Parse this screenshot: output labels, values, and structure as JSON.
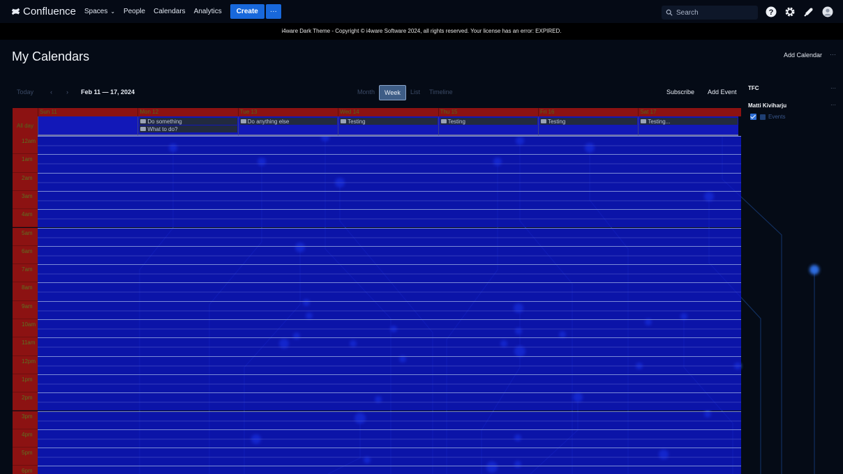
{
  "topnav": {
    "logo_text": "Confluence",
    "spaces": "Spaces",
    "people": "People",
    "calendars": "Calendars",
    "analytics": "Analytics",
    "create": "Create",
    "more": "···",
    "search_placeholder": "Search",
    "icons": [
      "help-icon",
      "settings-icon",
      "notifications-icon",
      "avatar-icon"
    ]
  },
  "banner": "i4ware Dark Theme - Copyright © i4ware Software 2024, all rights reserved. Your license has an error: EXPIRED.",
  "page": {
    "title": "My Calendars",
    "add_calendar": "Add Calendar",
    "more": "···"
  },
  "toolbar": {
    "today": "Today",
    "prev": "‹",
    "next": "›",
    "range": "Feb 11 — 17, 2024",
    "views": {
      "month": "Month",
      "week": "Week",
      "list": "List",
      "timeline": "Timeline"
    },
    "selected_view": "Week",
    "subscribe": "Subscribe",
    "add_event": "Add Event"
  },
  "calendar": {
    "days": [
      "Sun 11",
      "Mon 12",
      "Tue 13",
      "Wed 14",
      "Thu 15",
      "Fri 16",
      "Sat 17"
    ],
    "allday_label": "All day",
    "allday_events": [
      [],
      [
        "Do something",
        "What to do?"
      ],
      [
        "Do anything else"
      ],
      [
        "Testing"
      ],
      [
        "Testing"
      ],
      [
        "Testing"
      ],
      [
        "Testing..."
      ]
    ],
    "hours": [
      "12am",
      "1am",
      "2am",
      "3am",
      "4am",
      "5am",
      "6am",
      "7am",
      "8am",
      "9am",
      "10am",
      "11am",
      "12pm",
      "1pm",
      "2pm",
      "3pm",
      "4pm",
      "5pm",
      "6pm"
    ]
  },
  "sidebar": {
    "group": "TFC",
    "group_more": "···",
    "user": "Matti Kiviharju",
    "user_more": "···",
    "calendar_name": "Events",
    "calendar_checked": true,
    "calendar_color": "#1f3f74"
  }
}
